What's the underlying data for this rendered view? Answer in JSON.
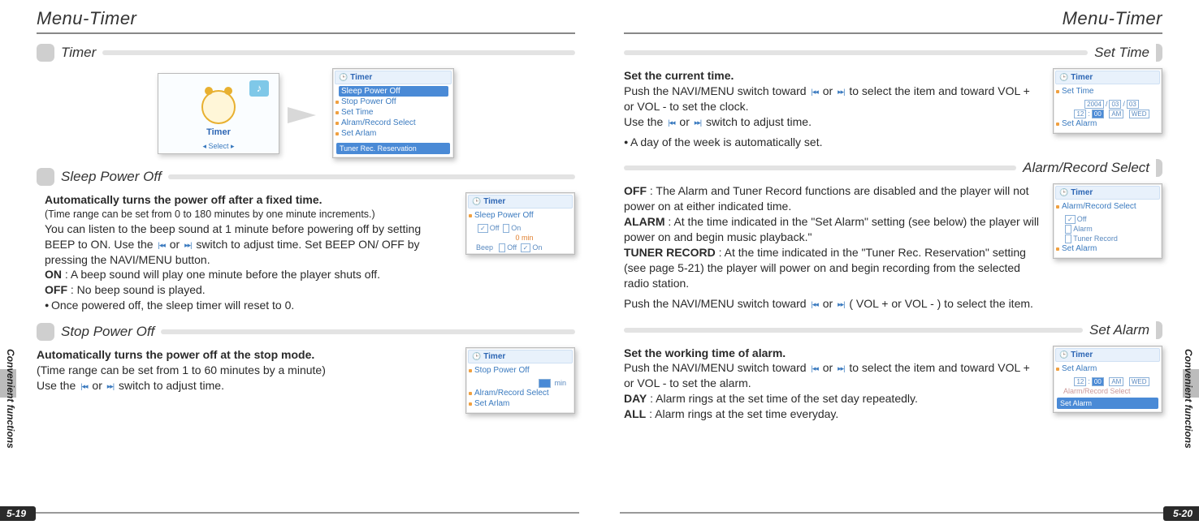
{
  "left": {
    "title": "Menu-Timer",
    "sidebar": "Convenient functions",
    "pgnum": "5-19",
    "sections": {
      "timer": {
        "label": "Timer",
        "hero_icon_label": "Timer",
        "hero_select": "◂ Select ▸",
        "lcd_title": "Timer",
        "items": [
          "Sleep Power Off",
          "Stop Power Off",
          "Set Time",
          "Alram/Record Select",
          "Set Arlam"
        ],
        "footer": "Tuner Rec. Reservation"
      },
      "sleep": {
        "label": "Sleep Power Off",
        "bold1": "Automatically turns the power off after a fixed time.",
        "small1": "(Time range can be set from 0 to 180 minutes by one minute increments.)",
        "line2a": "You can listen to the beep sound at 1 minute before powering off by setting BEEP to ON. Use the ",
        "line2b": " or ",
        "line2c": " switch to adjust time. Set  BEEP ON/ OFF by pressing the NAVI/MENU button.",
        "on": "ON",
        "on_desc": " : A beep sound will play one minute before the player shuts off.",
        "off": "OFF",
        "off_desc": " : No beep sound is played.",
        "bullet": "Once powered off, the sleep timer will reset to 0.",
        "lcd_title": "Timer",
        "lcd_row1": "Sleep Power Off",
        "lcd_opt_off": "Off",
        "lcd_opt_on": "On",
        "lcd_val": "0 min",
        "lcd_beep": "Beep",
        "lcd_bp_off": "Off",
        "lcd_bp_on": "On"
      },
      "stop": {
        "label": "Stop Power Off",
        "bold1": "Automatically turns the power off at the stop mode.",
        "line1": "(Time range can be set from 1 to 60 minutes by a minute)",
        "line2a": "Use the ",
        "line2b": " or ",
        "line2c": " switch to adjust time.",
        "lcd_title": "Timer",
        "lcd_row1": "Stop Power Off",
        "lcd_val": "min",
        "lcd_r2": "Alram/Record Select",
        "lcd_r3": "Set Arlam"
      }
    }
  },
  "right": {
    "title": "Menu-Timer",
    "sidebar": "Convenient functions",
    "pgnum": "5-20",
    "sections": {
      "settime": {
        "label": "Set Time",
        "bold1": "Set the current time.",
        "l1a": "Push the NAVI/MENU switch toward ",
        "l1b": " or ",
        "l1c": " to select the item and toward VOL + or VOL - to set the clock.",
        "l2a": "Use the ",
        "l2b": " or ",
        "l2c": " switch to adjust time.",
        "bullet": "A day of the week is automatically set.",
        "lcd_title": "Timer",
        "lcd_row1": "Set Time",
        "lcd_date": "2004 / 03 / 03",
        "lcd_time": "12 : 00 AM WED",
        "lcd_last": "Set Alarm"
      },
      "alarmrec": {
        "label": "Alarm/Record Select",
        "off": "OFF",
        "off_desc": " : The Alarm and Tuner Record functions are disabled and the player will not power on at either indicated time.",
        "alarm": "ALARM",
        "alarm_desc": " : At the time indicated in the \"Set Alarm\" setting (see below) the player will power on and begin music playback.\"",
        "tuner": "TUNER RECORD",
        "tuner_desc": " : At the time indicated in the \"Tuner Rec. Reservation\" setting (see page 5-21) the player will power on and begin recording from the selected radio station.",
        "pusha": "Push the NAVI/MENU switch toward ",
        "pushb": " or ",
        "pushc": " ( VOL + or VOL - ) to select the item.",
        "lcd_title": "Timer",
        "lcd_row1": "Alarm/Record Select",
        "lcd_o1": "Off",
        "lcd_o2": "Alarm",
        "lcd_o3": "Tuner Record",
        "lcd_last": "Set Alarm"
      },
      "setalarm": {
        "label": "Set Alarm",
        "bold1": "Set the working time of alarm.",
        "l1a": "Push the NAVI/MENU switch toward ",
        "l1b": " or ",
        "l1c": " to select the item and toward VOL + or VOL - to set the alarm.",
        "day": "DAY",
        "day_desc": " : Alarm rings at the set time of the set day repeatedly.",
        "all": "ALL",
        "all_desc": " : Alarm rings at the set time everyday.",
        "lcd_title": "Timer",
        "lcd_row0": "Set Alarm",
        "lcd_time": "12 : 00 AM WED",
        "lcd_r2": "Alarm/Record Select",
        "lcd_r3": "Set Alarm"
      }
    }
  },
  "icons": {
    "left_arrows": "|◂◂",
    "right_arrows": "▸▸|"
  }
}
